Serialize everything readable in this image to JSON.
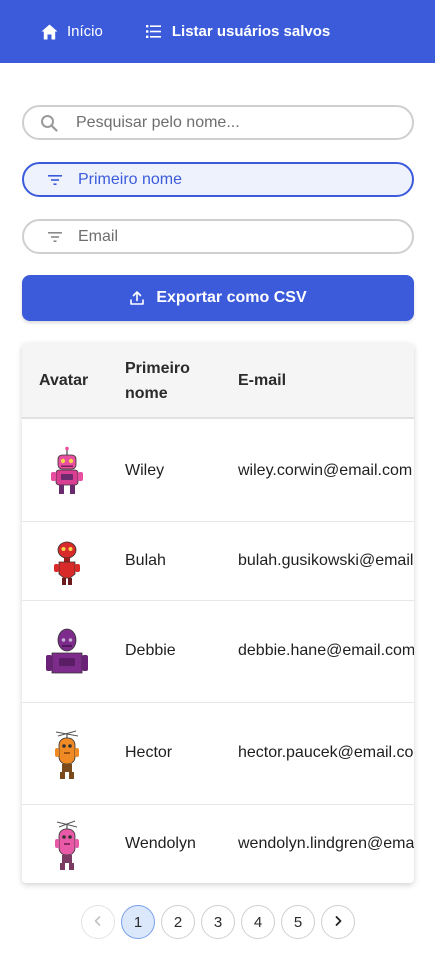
{
  "nav": {
    "home_label": "Início",
    "list_label": "Listar usuários salvos"
  },
  "search": {
    "placeholder": "Pesquisar pelo nome..."
  },
  "filters": {
    "first_name_placeholder": "Primeiro nome",
    "email_placeholder": "Email"
  },
  "export_label": "Exportar como CSV",
  "table": {
    "headers": {
      "avatar": "Avatar",
      "first_name": "Primeiro nome",
      "email": "E-mail"
    },
    "rows": [
      {
        "first_name": "Wiley",
        "email": "wiley.corwin@email.com"
      },
      {
        "first_name": "Bulah",
        "email": "bulah.gusikowski@email.com"
      },
      {
        "first_name": "Debbie",
        "email": "debbie.hane@email.com"
      },
      {
        "first_name": "Hector",
        "email": "hector.paucek@email.com"
      },
      {
        "first_name": "Wendolyn",
        "email": "wendolyn.lindgren@email.com"
      }
    ]
  },
  "pagination": {
    "pages": [
      "1",
      "2",
      "3",
      "4",
      "5"
    ],
    "current": "1"
  },
  "colors": {
    "primary": "#3b5bdb",
    "active_page_bg": "#dbe7fb"
  },
  "icons": {
    "home": "home-icon",
    "list": "list-icon",
    "search": "search-icon",
    "filter": "filter-icon",
    "upload": "upload-icon",
    "prev": "chevron-left-icon",
    "next": "chevron-right-icon"
  }
}
